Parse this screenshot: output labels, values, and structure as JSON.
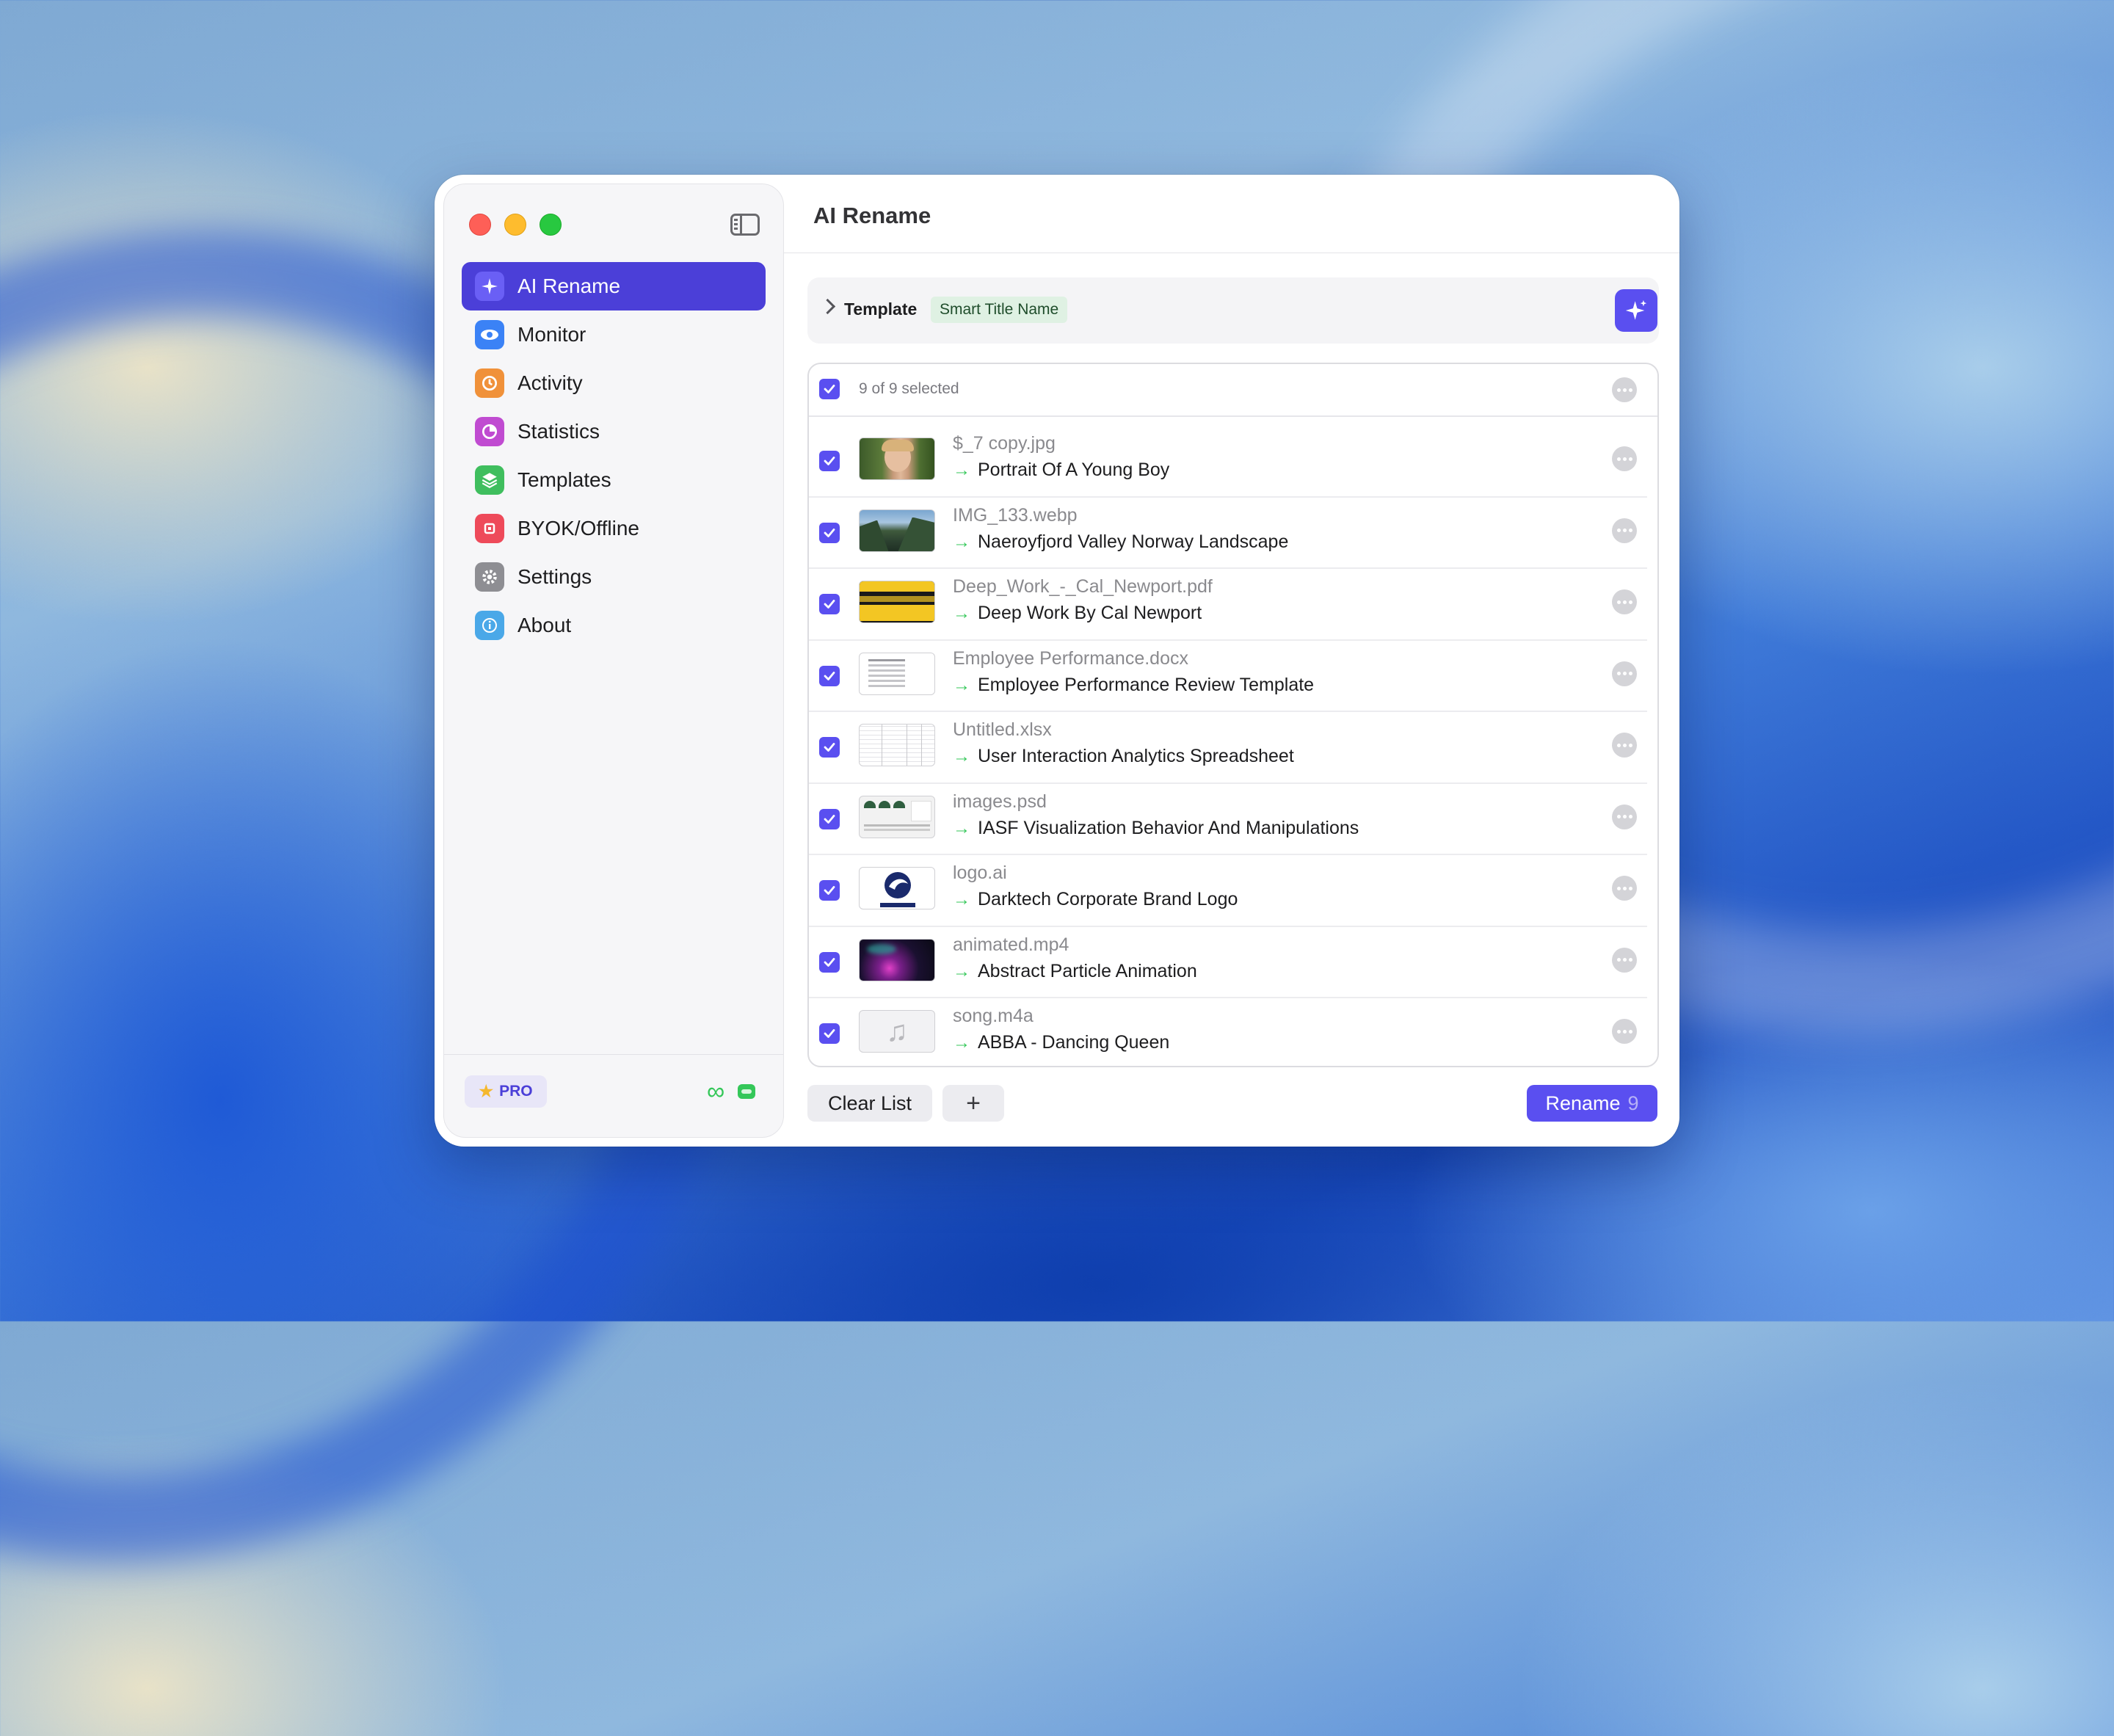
{
  "window": {
    "title": "AI Rename"
  },
  "sidebar": {
    "items": [
      {
        "label": "AI Rename",
        "icon": "sparkles-icon",
        "color": "#6a5ff5",
        "active": true
      },
      {
        "label": "Monitor",
        "icon": "eye-icon",
        "color": "#3b82f6",
        "active": false
      },
      {
        "label": "Activity",
        "icon": "clock-arrow-icon",
        "color": "#f0913a",
        "active": false
      },
      {
        "label": "Statistics",
        "icon": "pie-chart-icon",
        "color": "#c04bd1",
        "active": false
      },
      {
        "label": "Templates",
        "icon": "layers-icon",
        "color": "#3fbe5e",
        "active": false
      },
      {
        "label": "BYOK/Offline",
        "icon": "chip-icon",
        "color": "#ee4a5a",
        "active": false
      },
      {
        "label": "Settings",
        "icon": "gear-icon",
        "color": "#8e8e93",
        "active": false
      },
      {
        "label": "About",
        "icon": "info-icon",
        "color": "#4aa8e8",
        "active": false
      }
    ],
    "pro_label": "PRO"
  },
  "template": {
    "label": "Template",
    "value": "Smart Title Name"
  },
  "list": {
    "selected_text": "9 of 9 selected",
    "files": [
      {
        "original": "$_7 copy.jpg",
        "renamed": "Portrait Of A Young Boy"
      },
      {
        "original": "IMG_133.webp",
        "renamed": "Naeroyfjord Valley Norway Landscape"
      },
      {
        "original": "Deep_Work_-_Cal_Newport.pdf",
        "renamed": "Deep Work By Cal Newport"
      },
      {
        "original": "Employee Performance.docx",
        "renamed": "Employee Performance Review Template"
      },
      {
        "original": "Untitled.xlsx",
        "renamed": "User Interaction Analytics Spreadsheet"
      },
      {
        "original": "images.psd",
        "renamed": "IASF Visualization Behavior And Manipulations"
      },
      {
        "original": "logo.ai",
        "renamed": "Darktech Corporate Brand Logo"
      },
      {
        "original": "animated.mp4",
        "renamed": "Abstract Particle Animation"
      },
      {
        "original": "song.m4a",
        "renamed": "ABBA - Dancing Queen"
      }
    ]
  },
  "actions": {
    "clear_label": "Clear List",
    "add_label": "+",
    "rename_label": "Rename",
    "rename_count": "9"
  },
  "colors": {
    "accent": "#5a4ff0",
    "arrow": "#34c759"
  }
}
